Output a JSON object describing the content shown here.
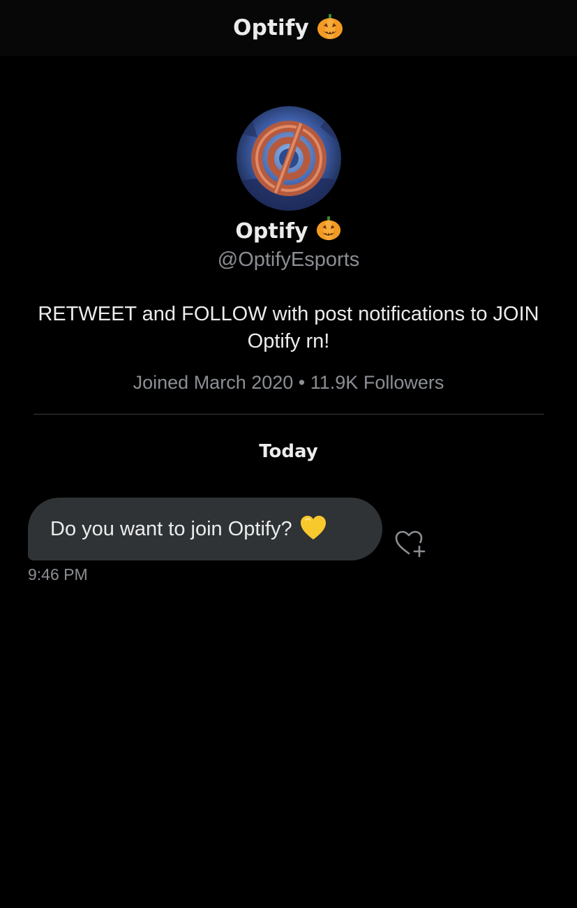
{
  "header": {
    "title": "Optify",
    "title_emoji": "jack-o-lantern"
  },
  "profile": {
    "avatar": "optify-crosshair-logo",
    "name": "Optify",
    "name_emoji": "jack-o-lantern",
    "handle": "@OptifyEsports",
    "bio": "RETWEET and FOLLOW with post notifications to JOIN Optify rn!",
    "joined": "Joined March 2020",
    "separator": "•",
    "followers": "11.9K Followers"
  },
  "conversation": {
    "day_label": "Today",
    "messages": [
      {
        "text": "Do you want to join Optify?",
        "emoji": "yellow-heart",
        "time": "9:46 PM"
      }
    ]
  },
  "colors": {
    "background": "#000000",
    "header_bg": "#070707",
    "bubble_bg": "#2f3336",
    "text_primary": "#ececec",
    "text_secondary": "#8b8f94",
    "divider": "#3a3d42"
  },
  "icons": {
    "react": "heart-plus-icon"
  }
}
